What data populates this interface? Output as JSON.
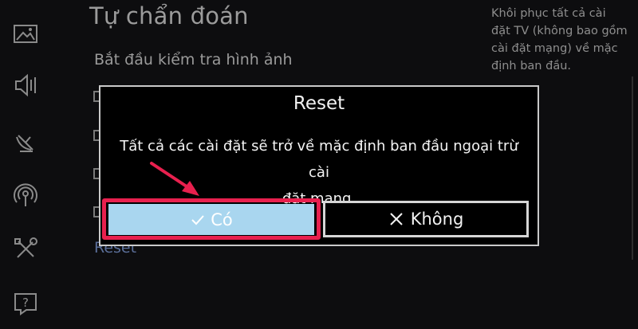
{
  "sidebar": {
    "icons": [
      "picture-icon",
      "sound-icon",
      "broadcast-icon",
      "network-icon",
      "tools-icon",
      "help-icon"
    ]
  },
  "menu": {
    "title": "Tự chẩn đoán",
    "items": [
      "Bắt đầu kiểm tra hình ảnh",
      "Reset"
    ]
  },
  "help_panel": {
    "lines": [
      "Khôi phục tất cả cài",
      "đặt TV (không bao gồm",
      "cài đặt mạng) về mặc",
      "định ban đầu."
    ]
  },
  "dialog": {
    "title": "Reset",
    "message_lines": [
      "Tất cả các cài đặt sẽ trở về mặc định ban đầu ngoại trừ cài",
      "đặt mạng."
    ],
    "yes_label": "Có",
    "no_label": "Không"
  },
  "colors": {
    "highlight_border": "#e8204e",
    "focused_button": "#a9d6ef",
    "background": "#0d0d0f"
  }
}
